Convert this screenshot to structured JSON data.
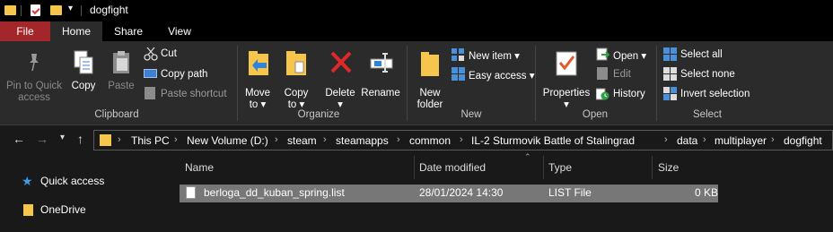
{
  "window": {
    "title": "dogfight"
  },
  "tabs": {
    "file": "File",
    "home": "Home",
    "share": "Share",
    "view": "View"
  },
  "clipboard": {
    "pin_line1": "Pin to Quick",
    "pin_line2": "access",
    "copy": "Copy",
    "paste": "Paste",
    "cut": "Cut",
    "copy_path": "Copy path",
    "paste_shortcut": "Paste shortcut",
    "label": "Clipboard"
  },
  "organize": {
    "move_line1": "Move",
    "move_line2": "to",
    "copy_line1": "Copy",
    "copy_line2": "to",
    "delete": "Delete",
    "rename": "Rename",
    "label": "Organize"
  },
  "new": {
    "folder_line1": "New",
    "folder_line2": "folder",
    "new_item": "New item",
    "easy_access": "Easy access",
    "label": "New"
  },
  "open": {
    "properties": "Properties",
    "open": "Open",
    "edit": "Edit",
    "history": "History",
    "label": "Open"
  },
  "select": {
    "select_all": "Select all",
    "select_none": "Select none",
    "invert": "Invert selection",
    "label": "Select"
  },
  "breadcrumb": [
    "This PC",
    "New Volume (D:)",
    "steam",
    "steamapps",
    "common",
    "IL-2 Sturmovik Battle of Stalingrad",
    "data",
    "multiplayer",
    "dogfight"
  ],
  "sidebar": {
    "quick_access": "Quick access",
    "onedrive": "OneDrive"
  },
  "columns": {
    "name": "Name",
    "date": "Date modified",
    "type": "Type",
    "size": "Size"
  },
  "files": [
    {
      "name": "berloga_dd_kuban_spring.list",
      "date": "28/01/2024 14:30",
      "type": "LIST File",
      "size": "0 KB"
    }
  ],
  "colors": {
    "file_tab": "#a3262a",
    "folder": "#f6c54c",
    "selected_row": "#777777"
  }
}
